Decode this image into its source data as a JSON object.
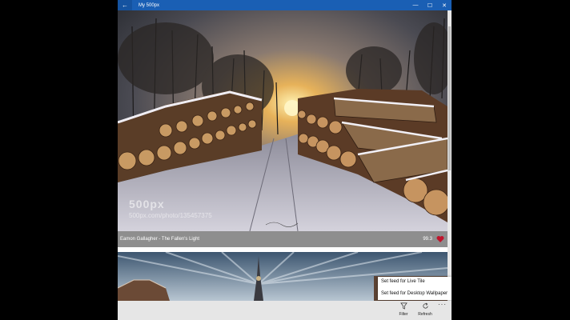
{
  "window": {
    "title": "My 500px"
  },
  "photos": [
    {
      "title": "Eamon Gallagher - The Fallen's Light",
      "score": "99.3",
      "watermark_logo": "500px",
      "watermark_url": "500px.com/photo/135457375"
    }
  ],
  "context_menu": {
    "items": [
      "Set feed for Live Tile",
      "Set feed for Desktop Wallpaper"
    ]
  },
  "appbar": {
    "filter_label": "Filter",
    "refresh_label": "Refresh",
    "more_label": "···"
  },
  "colors": {
    "titlebar": "#1a5fb4",
    "heart": "#c0142c",
    "caption_bg": "#8e8e8e"
  }
}
